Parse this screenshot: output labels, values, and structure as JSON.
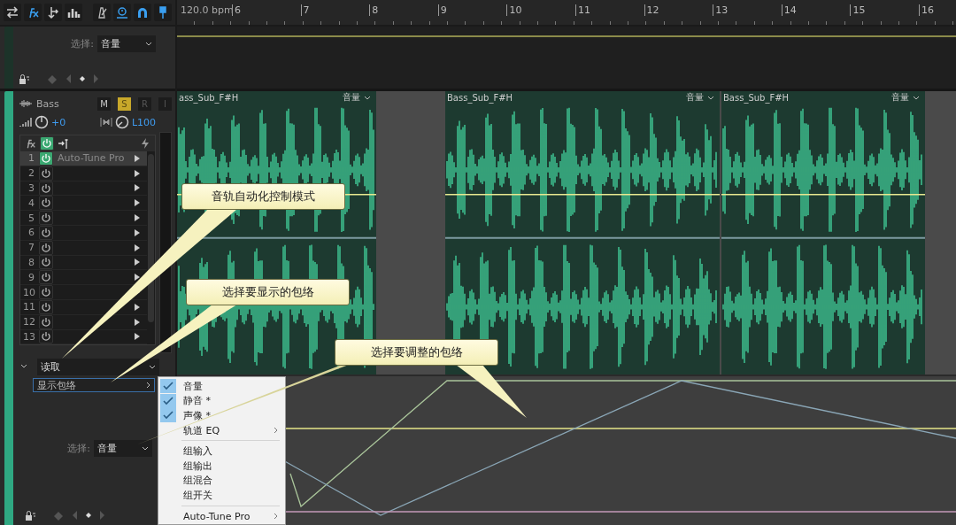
{
  "ruler": {
    "tempo": "120.0 bpm",
    "marks": [
      "6",
      "7",
      "8",
      "9",
      "10",
      "11",
      "12",
      "13",
      "14",
      "15",
      "16"
    ]
  },
  "upper_lane": {
    "select_label": "选择:",
    "select_value": "音量"
  },
  "track": {
    "name": "Bass",
    "buttons": [
      {
        "label": "M",
        "on": false,
        "disabled": false
      },
      {
        "label": "S",
        "on": true,
        "disabled": false
      },
      {
        "label": "R",
        "on": false,
        "disabled": true
      },
      {
        "label": "I",
        "on": false,
        "disabled": true
      }
    ],
    "volume": "+0",
    "pan": "L100",
    "effects": [
      {
        "index": "1",
        "name": "Auto-Tune Pro",
        "on": true
      },
      {
        "index": "2",
        "on": false
      },
      {
        "index": "3",
        "on": false
      },
      {
        "index": "4",
        "on": false
      },
      {
        "index": "5",
        "on": false
      },
      {
        "index": "6",
        "on": false
      },
      {
        "index": "7",
        "on": false
      },
      {
        "index": "8",
        "on": false
      },
      {
        "index": "9",
        "on": false
      },
      {
        "index": "10",
        "on": false
      },
      {
        "index": "11",
        "on": false
      },
      {
        "index": "12",
        "on": false
      },
      {
        "index": "13",
        "on": false
      }
    ],
    "automation_mode": "读取",
    "show_envelopes": "显示包络",
    "select_label": "选择:",
    "select_value": "音量"
  },
  "clips": [
    {
      "name": "ass_Sub_F#H",
      "envelope": "音量"
    },
    {
      "name": "Bass_Sub_F#H",
      "envelope": "音量"
    },
    {
      "name": "Bass_Sub_F#H",
      "envelope": "音量"
    }
  ],
  "envelope_menu": {
    "sections": [
      {
        "items": [
          {
            "kind": "toggle",
            "label": "音量",
            "checked": true
          },
          {
            "kind": "toggle",
            "label": "静音 *",
            "checked": true
          },
          {
            "kind": "toggle",
            "label": "声像 *",
            "checked": true
          },
          {
            "kind": "submenu",
            "label": "轨道 EQ"
          }
        ]
      },
      {
        "items": [
          {
            "kind": "command",
            "label": "组输入"
          },
          {
            "kind": "command",
            "label": "组输出"
          },
          {
            "kind": "command",
            "label": "组混合"
          },
          {
            "kind": "command",
            "label": "组开关"
          }
        ]
      },
      {
        "items": [
          {
            "kind": "submenu",
            "label": "Auto-Tune Pro"
          }
        ]
      }
    ]
  },
  "callouts": [
    {
      "text": "音轨自动化控制模式"
    },
    {
      "text": "选择要显示的包络"
    },
    {
      "text": "选择要调整的包络"
    }
  ]
}
